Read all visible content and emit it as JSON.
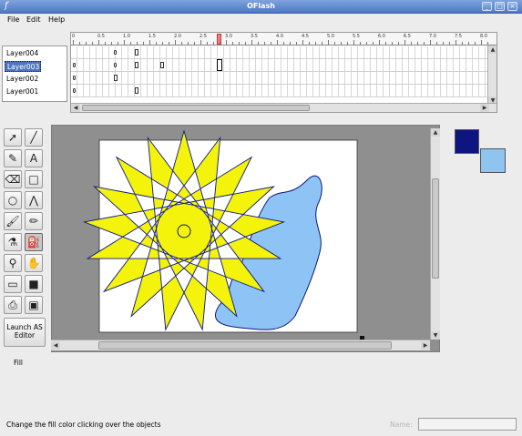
{
  "window": {
    "title": "OFlash",
    "app_icon": "f",
    "buttons": [
      "_",
      "□",
      "×"
    ]
  },
  "menu": [
    "File",
    "Edit",
    "Help"
  ],
  "layers": [
    {
      "label": "Layer004",
      "selected": false
    },
    {
      "label": "Layer003",
      "selected": true
    },
    {
      "label": "Layer002",
      "selected": false
    },
    {
      "label": "Layer001",
      "selected": false
    }
  ],
  "timeline": {
    "ruler_labels": [
      "0",
      "0.5",
      "1.0",
      "1.5",
      "2.0",
      "2.5",
      "3.0",
      "3.5",
      "4.0",
      "4.5",
      "5.0",
      "5.5",
      "6.0",
      "6.5",
      "7.0",
      "7.5",
      "8.0"
    ]
  },
  "tools": [
    {
      "icon": "arrow-select-icon",
      "glyph": "➚"
    },
    {
      "icon": "line-icon",
      "glyph": "╱"
    },
    {
      "icon": "pen-icon",
      "glyph": "✎"
    },
    {
      "icon": "text-icon",
      "glyph": "A"
    },
    {
      "icon": "eraser-icon",
      "glyph": "⌫"
    },
    {
      "icon": "rectangle-icon",
      "glyph": "□"
    },
    {
      "icon": "ellipse-icon",
      "glyph": "○"
    },
    {
      "icon": "polyline-icon",
      "glyph": "⋀"
    },
    {
      "icon": "brush-icon",
      "glyph": "🖌"
    },
    {
      "icon": "pencil-icon",
      "glyph": "✏"
    },
    {
      "icon": "ink-bottle-icon",
      "glyph": "⚗"
    },
    {
      "icon": "paint-bucket-icon",
      "glyph": "⛽"
    },
    {
      "icon": "zoom-icon",
      "glyph": "⚲"
    },
    {
      "icon": "hand-icon",
      "glyph": "✋"
    },
    {
      "icon": "text-box-icon",
      "glyph": "▭"
    },
    {
      "icon": "square-fill-icon",
      "glyph": "■"
    },
    {
      "icon": "import-icon",
      "glyph": "⎙"
    },
    {
      "icon": "movie-icon",
      "glyph": "▣"
    }
  ],
  "active_tool": "paint-bucket-icon",
  "launch_button": "Launch AS Editor",
  "current_tool_label": "Fill",
  "colors": {
    "stroke": "#0d1580",
    "fill": "#8ec4ef",
    "star_fill": "#f3f30c",
    "blob_fill": "#8ec4f5",
    "accent": "#4e75bd"
  },
  "status": {
    "message": "Change the fill color clicking over the objects",
    "name_label": "Name:",
    "name_value": ""
  }
}
